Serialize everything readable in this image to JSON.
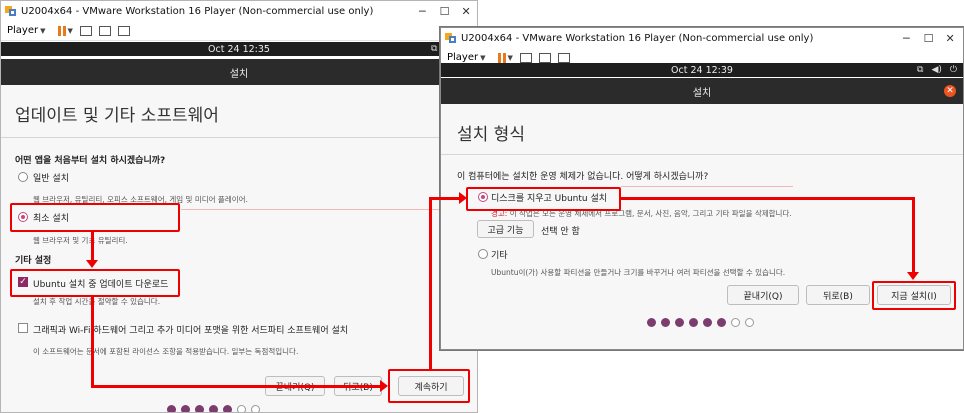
{
  "left_window": {
    "title": "U2004x64 - VMware Workstation 16 Player (Non-commercial use only)",
    "player_menu": "Player",
    "clock": "Oct 24  12:35",
    "header": "설치",
    "page_title": "업데이트 및 기타 소프트웨어",
    "question": "어떤 앱을 처음부터 설치 하시겠습니까?",
    "normal_install": "일반 설치",
    "normal_desc": "웹 브라우저, 유틸리티, 오피스 소프트웨어, 게임 및 미디어 플레이어.",
    "minimal_install": "최소 설치",
    "minimal_desc": "웹 브라우저 및 기초 유틸리티.",
    "other_settings": "기타 설정",
    "download_updates": "Ubuntu 설치 중 업데이트 다운로드",
    "download_desc": "설치 후 작업 시간을 절약할 수 있습니다.",
    "third_party": "그래픽과 Wi-Fi 하드웨어 그리고 추가 미디어 포맷을 위한 서드파티 소프트웨어 설치",
    "third_party_desc": "이 소프트웨어는 문서에 포함된 라이선스 조항을 적용받습니다. 일부는 독점적입니다.",
    "quit": "끝내기(Q)",
    "back": "뒤로(B)",
    "continue": "계속하기"
  },
  "right_window": {
    "title": "U2004x64 - VMware Workstation 16 Player (Non-commercial use only)",
    "player_menu": "Player",
    "clock": "Oct 24  12:39",
    "header": "설치",
    "page_title": "설치 형식",
    "question": "이 컴퓨터에는 설치한 운영 체제가 없습니다. 어떻게 하시겠습니까?",
    "erase_option": "디스크를 지우고 Ubuntu 설치",
    "warning_label": "경고:",
    "warning_text": " 이 작업은 모든 운영 체제에서 프로그램, 문서, 사진, 음악, 그리고 기타 파일을 삭제합니다.",
    "advanced_button": "고급 기능",
    "advanced_status": "선택 안 함",
    "other_option": "기타",
    "other_desc": "Ubuntu이(가) 사용할 파티션을 만들거나 크기를 바꾸거나 여러 파티션을 선택할 수 있습니다.",
    "quit": "끝내기(Q)",
    "back": "뒤로(B)",
    "install_now": "지금 설치(I)"
  },
  "colors": {
    "annotation_red": "#e00000",
    "ubuntu_purple": "#8e2966",
    "ubuntu_orange": "#e95420"
  }
}
